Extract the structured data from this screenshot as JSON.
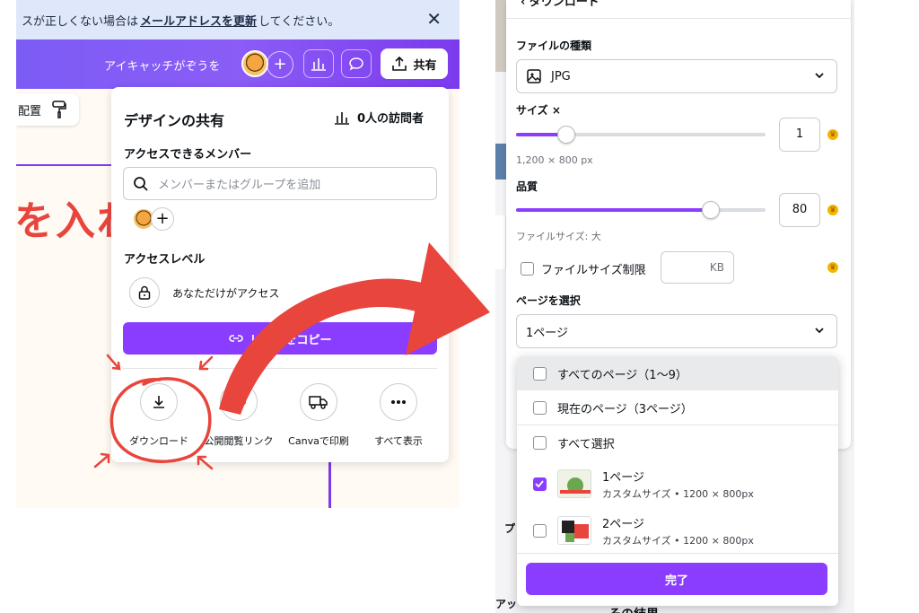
{
  "left": {
    "notice": {
      "prefix": "スが正しくない場合は",
      "link": "メールアドレスを更新",
      "suffix": "してください。"
    },
    "header": {
      "design_title": "アイキャッチがぞうを",
      "share_label": "共有"
    },
    "toolbar": {
      "arrange_label": "配置"
    },
    "canvas": {
      "big_text": "を入れ"
    },
    "share_panel": {
      "title": "デザインの共有",
      "visitors": "0人の訪問者",
      "members_label": "アクセスできるメンバー",
      "search_placeholder": "メンバーまたはグループを追加",
      "access_level_label": "アクセスレベル",
      "access_text": "あなただけがアクセス",
      "copy_link_label": "リンクをコピー",
      "actions": [
        {
          "label": "ダウンロード",
          "icon": "download-icon"
        },
        {
          "label": "公開閲覧リンク",
          "icon": "link-icon"
        },
        {
          "label": "Canvaで印刷",
          "icon": "truck-icon"
        },
        {
          "label": "すべて表示",
          "icon": "more-icon"
        }
      ]
    }
  },
  "right": {
    "download_panel": {
      "header": "ダウンロード",
      "file_type_label": "ファイルの種類",
      "file_type_value": "JPG",
      "size_label": "サイズ ×",
      "size_value": "1",
      "size_dimensions": "1,200 × 800 px",
      "size_fraction": 0.2,
      "quality_label": "品質",
      "quality_value": "80",
      "quality_fraction": 0.78,
      "file_size_text": "ファイルサイズ: 大",
      "limit_label": "ファイルサイズ制限",
      "limit_unit": "KB",
      "page_select_label": "ページを選択",
      "page_select_value": "1ページ"
    },
    "page_dropdown": {
      "all_pages": "すべてのページ（1〜9）",
      "current_page": "現在のページ（3ページ）",
      "select_all": "すべて選択",
      "pages": [
        {
          "title": "1ページ",
          "subtitle": "カスタムサイズ • 1200 × 800px",
          "checked": true
        },
        {
          "title": "2ページ",
          "subtitle": "カスタムサイズ • 1200 × 800px",
          "checked": false
        }
      ],
      "done_label": "完了"
    },
    "background": {
      "partial_left_1": "プ",
      "partial_left_2": "アッ",
      "partial_bottom": "その結果"
    }
  },
  "colors": {
    "accent": "#8b3dff",
    "annotation_red": "#e8453c",
    "notice_bg": "#dfe7fb"
  }
}
